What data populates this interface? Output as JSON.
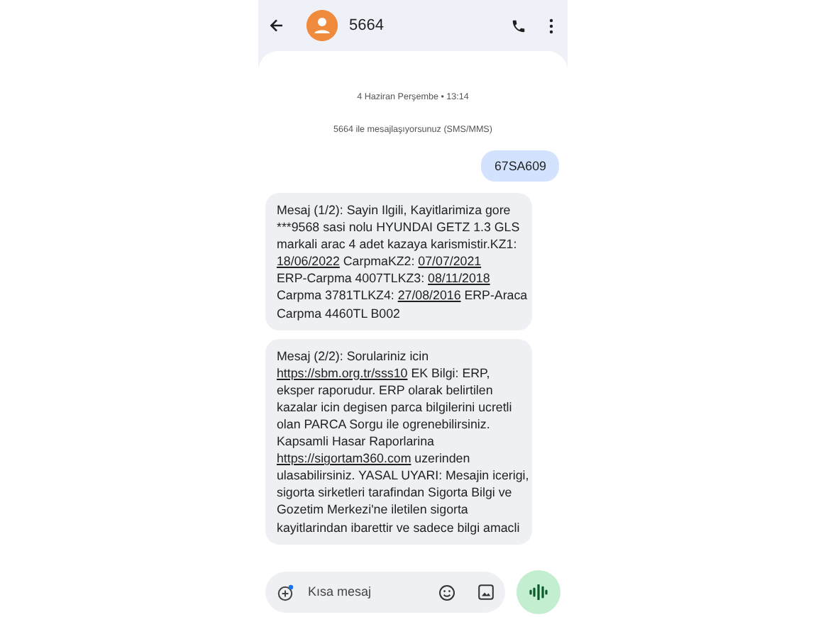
{
  "header": {
    "title": "5664"
  },
  "thread": {
    "date": "4 Haziran Perşembe • 13:14",
    "info": "5664 ile mesajlaşıyorsunuz (SMS/MMS)"
  },
  "messages": [
    {
      "kind": "sent",
      "lines": [
        [
          {
            "text": "67SA609",
            "kind": "text"
          }
        ]
      ]
    },
    {
      "kind": "received",
      "lines": [
        [
          {
            "text": "Mesaj (1/2): Sayin Ilgili, Kayitlarimiza gore",
            "kind": "text"
          }
        ],
        [
          {
            "text": "***9568 sasi nolu HYUNDAI GETZ 1.3 GLS",
            "kind": "text"
          }
        ],
        [
          {
            "text": "markali arac 4 adet kazaya karismistir.KZ1:",
            "kind": "text"
          }
        ],
        [
          {
            "text": "18/06/2022",
            "kind": "link"
          },
          {
            "text": " CarpmaKZ2: ",
            "kind": "text"
          },
          {
            "text": "07/07/2021",
            "kind": "link"
          }
        ],
        [
          {
            "text": "ERP-Carpma 4007TLKZ3: ",
            "kind": "text"
          },
          {
            "text": "08/11/2018",
            "kind": "link"
          }
        ],
        [
          {
            "text": "Carpma 3781TLKZ4: ",
            "kind": "text"
          },
          {
            "text": "27/08/2016",
            "kind": "link"
          },
          {
            "text": " ERP-Araca",
            "kind": "text"
          }
        ],
        [
          {
            "text": "Carpma 4460TL B002",
            "kind": "text"
          }
        ]
      ]
    },
    {
      "kind": "received",
      "lines": [
        [
          {
            "text": "Mesaj (2/2): Sorulariniz icin",
            "kind": "text"
          }
        ],
        [
          {
            "text": "https://sbm.org.tr/sss10",
            "kind": "link"
          },
          {
            "text": " EK Bilgi: ERP,",
            "kind": "text"
          }
        ],
        [
          {
            "text": "eksper raporudur. ERP olarak belirtilen",
            "kind": "text"
          }
        ],
        [
          {
            "text": "kazalar icin degisen parca bilgilerini ucretli",
            "kind": "text"
          }
        ],
        [
          {
            "text": "olan PARCA Sorgu ile ogrenebilirsiniz.",
            "kind": "text"
          }
        ],
        [
          {
            "text": "Kapsamli Hasar Raporlarina",
            "kind": "text"
          }
        ],
        [
          {
            "text": "https://sigortam360.com",
            "kind": "link"
          },
          {
            "text": " uzerinden",
            "kind": "text"
          }
        ],
        [
          {
            "text": "ulasabilirsiniz. YASAL UYARI: Mesajin icerigi,",
            "kind": "text"
          }
        ],
        [
          {
            "text": "sigorta sirketleri tarafindan Sigorta Bilgi ve",
            "kind": "text"
          }
        ],
        [
          {
            "text": "Gozetim Merkezi'ne iletilen sigorta",
            "kind": "text"
          }
        ],
        [
          {
            "text": "kayitlarindan ibarettir ve sadece bilgi amacli",
            "kind": "text"
          }
        ]
      ]
    }
  ],
  "composer": {
    "placeholder": "Kısa mesaj"
  }
}
